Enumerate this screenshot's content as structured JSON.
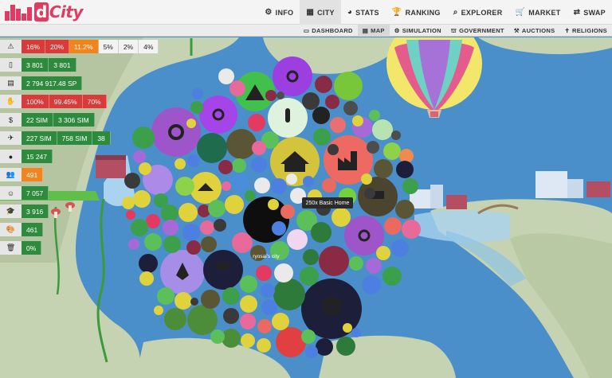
{
  "logo": {
    "text": "City",
    "badge": "d"
  },
  "nav": [
    {
      "label": "INFO",
      "icon": "gear-icon",
      "glyph": "⚙"
    },
    {
      "label": "CITY",
      "icon": "buildings-icon",
      "glyph": "▦"
    },
    {
      "label": "STATS",
      "icon": "pie-chart-icon",
      "glyph": "◕"
    },
    {
      "label": "RANKING",
      "icon": "trophy-icon",
      "glyph": "🏆"
    },
    {
      "label": "EXPLORER",
      "icon": "search-icon",
      "glyph": "⌕"
    },
    {
      "label": "MARKET",
      "icon": "cart-icon",
      "glyph": "🛒"
    },
    {
      "label": "SWAP",
      "icon": "swap-icon",
      "glyph": "⇄"
    }
  ],
  "active_nav": "CITY",
  "subnav": [
    {
      "label": "DASHBOARD",
      "icon": "monitor-icon",
      "glyph": "▭"
    },
    {
      "label": "MAP",
      "icon": "map-icon",
      "glyph": "▤"
    },
    {
      "label": "SIMULATION",
      "icon": "gears-icon",
      "glyph": "⚙"
    },
    {
      "label": "GOVERNMENT",
      "icon": "government-icon",
      "glyph": "⛫"
    },
    {
      "label": "AUCTIONS",
      "icon": "gavel-icon",
      "glyph": "⚒"
    },
    {
      "label": "RELIGIONS",
      "icon": "religion-icon",
      "glyph": "✝"
    }
  ],
  "active_subnav": "MAP",
  "stats": [
    {
      "icon": "warning-icon",
      "glyph": "⚠",
      "chips": [
        {
          "v": "16%",
          "c": "red"
        },
        {
          "v": "20%",
          "c": "red"
        },
        {
          "v": "11.2%",
          "c": "orange"
        },
        {
          "v": "5%",
          "c": "white"
        },
        {
          "v": "2%",
          "c": "white"
        },
        {
          "v": "4%",
          "c": "white"
        }
      ]
    },
    {
      "icon": "building-icon",
      "glyph": "▯",
      "chips": [
        {
          "v": "3 801",
          "c": "green"
        },
        {
          "v": "3 801",
          "c": "green"
        }
      ]
    },
    {
      "icon": "money-icon",
      "glyph": "▤",
      "chips": [
        {
          "v": "2 794 917.48 SP",
          "c": "green"
        }
      ]
    },
    {
      "icon": "hand-icon",
      "glyph": "✋",
      "chips": [
        {
          "v": "100%",
          "c": "red"
        },
        {
          "v": "99.45%",
          "c": "red"
        },
        {
          "v": "70%",
          "c": "red"
        }
      ]
    },
    {
      "icon": "dollar-icon",
      "glyph": "$",
      "chips": [
        {
          "v": "22 SIM",
          "c": "green"
        },
        {
          "v": "3 306 SIM",
          "c": "green"
        }
      ]
    },
    {
      "icon": "plane-icon",
      "glyph": "✈",
      "chips": [
        {
          "v": "227 SIM",
          "c": "green"
        },
        {
          "v": "758 SIM",
          "c": "green"
        },
        {
          "v": "38",
          "c": "green"
        }
      ]
    },
    {
      "icon": "person-icon",
      "glyph": "●",
      "chips": [
        {
          "v": "15 247",
          "c": "green"
        }
      ]
    },
    {
      "icon": "users-icon",
      "glyph": "👥",
      "chips": [
        {
          "v": "491",
          "c": "orange"
        }
      ]
    },
    {
      "icon": "smile-icon",
      "glyph": "☺",
      "chips": [
        {
          "v": "7 057",
          "c": "green"
        }
      ]
    },
    {
      "icon": "graduation-icon",
      "glyph": "🎓",
      "chips": [
        {
          "v": "3 916",
          "c": "green"
        }
      ]
    },
    {
      "icon": "palette-icon",
      "glyph": "🎨",
      "chips": [
        {
          "v": "461",
          "c": "green"
        }
      ]
    },
    {
      "icon": "trash-icon",
      "glyph": "🗑",
      "chips": [
        {
          "v": "0%",
          "c": "green"
        }
      ]
    }
  ],
  "tooltip": "250x Basic Home",
  "city_label": "ryosai's city",
  "colors": {
    "water": "#4a8fc9",
    "land": "#c5d3b2",
    "chip_red": "#d93a3a",
    "chip_green": "#2e8b3e",
    "chip_orange": "#f0851d",
    "brand": "#e23a61"
  }
}
